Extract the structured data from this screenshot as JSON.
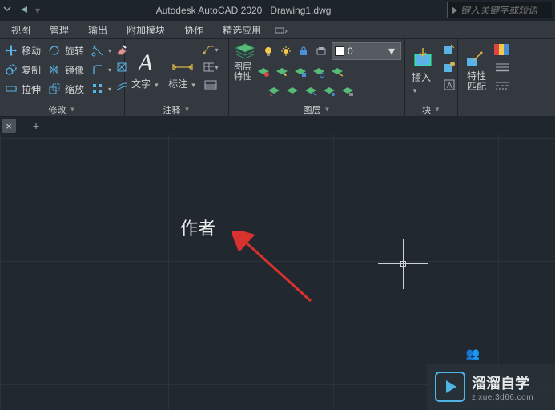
{
  "title": {
    "app": "Autodesk AutoCAD 2020",
    "doc": "Drawing1.dwg"
  },
  "search": {
    "placeholder": "键入关键字或短语"
  },
  "menus": [
    "视图",
    "管理",
    "输出",
    "附加模块",
    "协作",
    "精选应用"
  ],
  "panels": {
    "modify": {
      "title": "修改",
      "rows": [
        {
          "icon": "move",
          "label": "移动"
        },
        {
          "icon": "copy",
          "label": "复制"
        },
        {
          "icon": "stretch",
          "label": "拉伸"
        }
      ],
      "rows2": [
        {
          "icon": "rotate",
          "label": "旋转"
        },
        {
          "icon": "mirror",
          "label": "镜像"
        },
        {
          "icon": "scale",
          "label": "缩放"
        }
      ],
      "tools": [
        "trim",
        "fillet",
        "array"
      ]
    },
    "annotate": {
      "title": "注释",
      "text_btn": "文字",
      "dim_btn": "标注"
    },
    "layers": {
      "title": "图层",
      "props_btn": "图层\n特性",
      "current": {
        "name": "0"
      }
    },
    "block": {
      "title": "块",
      "insert_btn": "插入"
    },
    "props": {
      "title": "特性\n匹配"
    }
  },
  "canvas": {
    "author_label": "作者"
  },
  "watermark": {
    "cn": "溜溜自学",
    "en": "zixue.3d66.com"
  }
}
